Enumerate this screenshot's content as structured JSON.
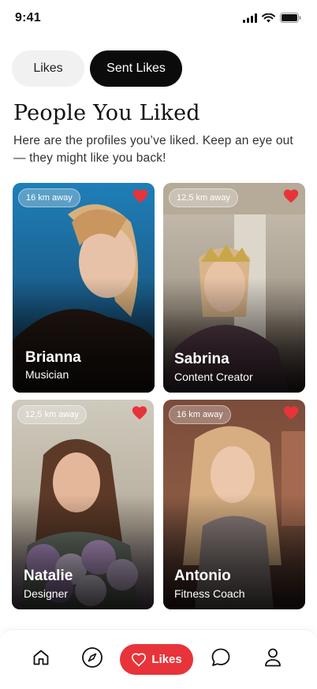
{
  "status_bar": {
    "time": "9:41"
  },
  "tabs": {
    "likes_label": "Likes",
    "sent_likes_label": "Sent Likes"
  },
  "header": {
    "title": "People You Liked",
    "subtitle": "Here are the profiles you’ve liked. Keep an eye out — they might like you back!"
  },
  "profiles": [
    {
      "distance": "16 km away",
      "name": "Brianna",
      "role": "Musician"
    },
    {
      "distance": "12,5 km away",
      "name": "Sabrina",
      "role": "Content Creator"
    },
    {
      "distance": "12,5 km away",
      "name": "Natalie",
      "role": "Designer"
    },
    {
      "distance": "16 km away",
      "name": "Antonio",
      "role": "Fitness Coach"
    }
  ],
  "bottom_nav": {
    "active_label": "Likes"
  },
  "colors": {
    "accent": "#e8333a",
    "active_tab_bg": "#0b0b0b",
    "inactive_tab_bg": "#f1f1f1"
  },
  "icons": [
    "signal-icon",
    "wifi-icon",
    "battery-icon",
    "heart-icon",
    "home-icon",
    "compass-icon",
    "chat-icon",
    "profile-icon"
  ]
}
